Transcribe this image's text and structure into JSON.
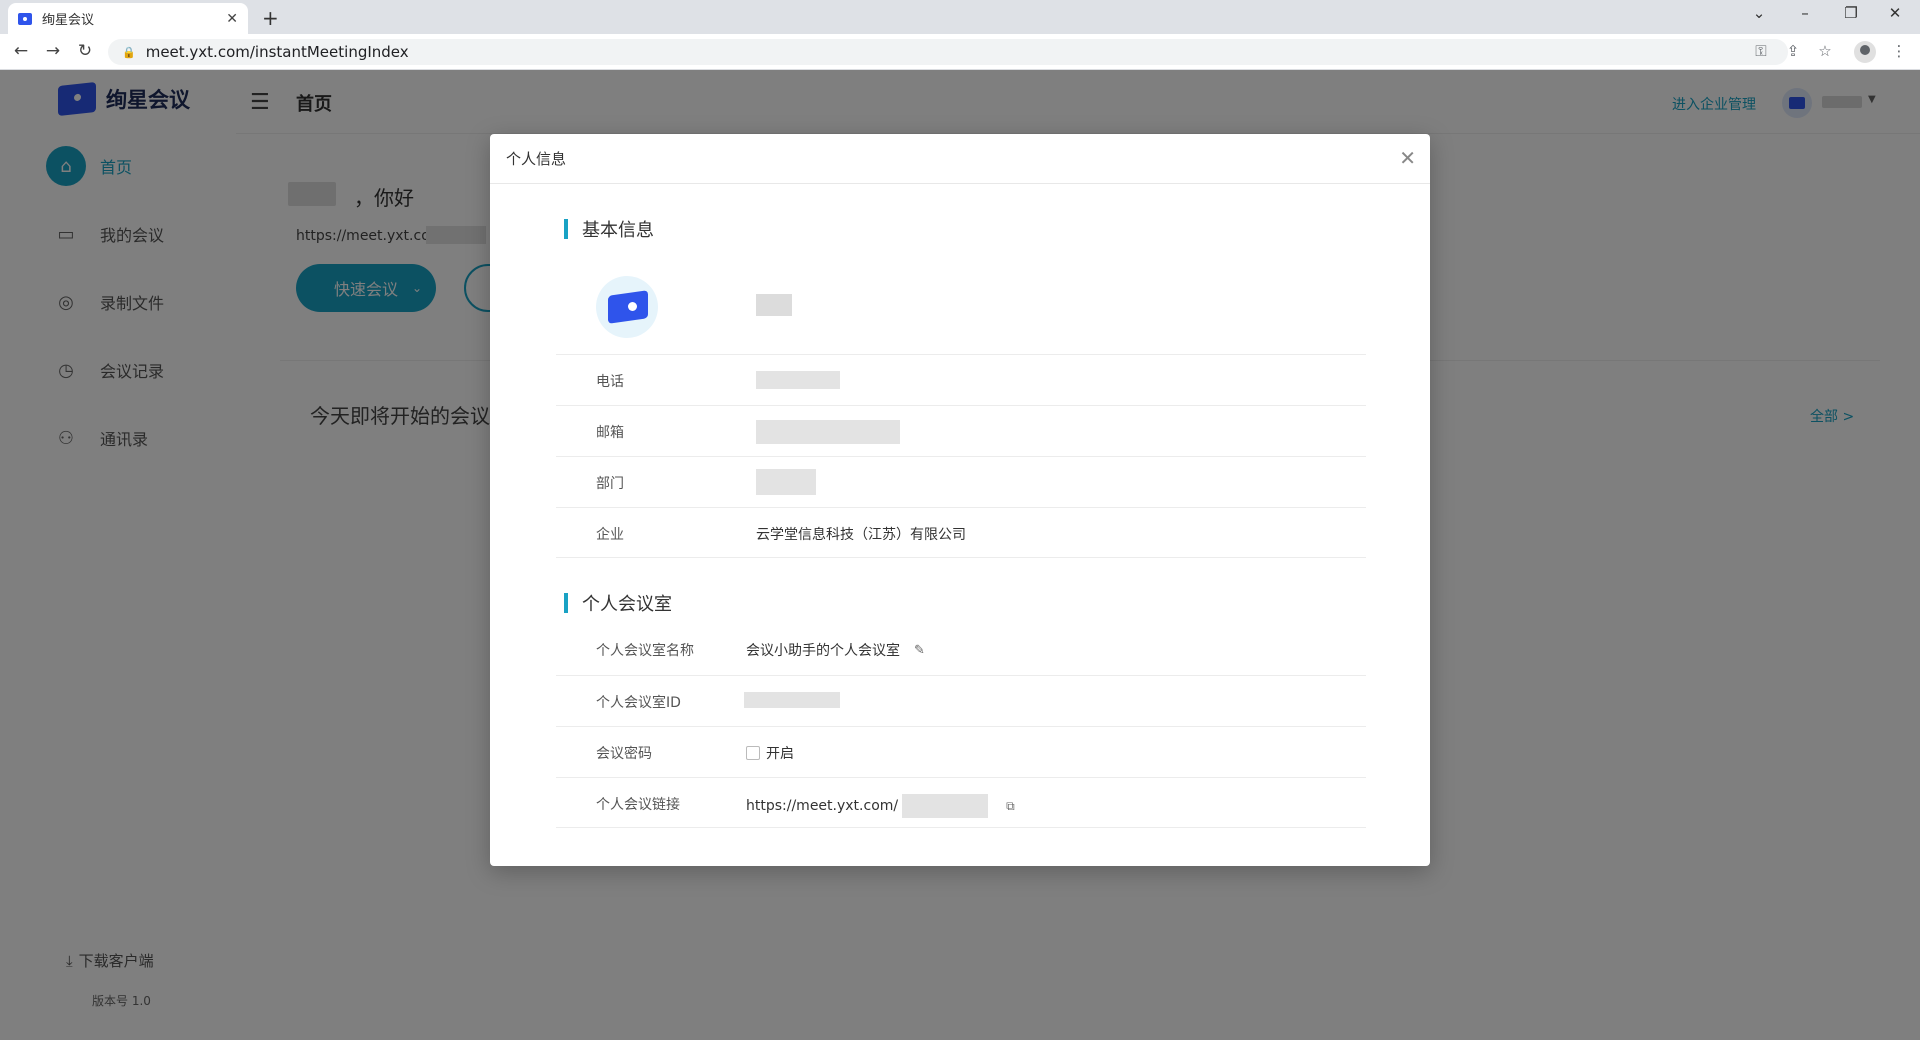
{
  "browser": {
    "tab_title": "绚星会议",
    "url": "meet.yxt.com/instantMeetingIndex"
  },
  "sidebar": {
    "brand": "绚星会议",
    "items": [
      {
        "label": "首页",
        "icon": "home-icon"
      },
      {
        "label": "我的会议",
        "icon": "calendar-icon"
      },
      {
        "label": "录制文件",
        "icon": "record-icon"
      },
      {
        "label": "会议记录",
        "icon": "clock-icon"
      },
      {
        "label": "通讯录",
        "icon": "contacts-icon"
      }
    ],
    "download_label": "下载客户端",
    "version": "版本号 1.0"
  },
  "header": {
    "title": "首页",
    "enterprise_link": "进入企业管理"
  },
  "main": {
    "greeting": "，你好",
    "link_prefix": "https://meet.yxt.com/",
    "quick_meeting": "快速会议",
    "upcoming_title": "今天即将开始的会议",
    "all_link": "全部 >"
  },
  "modal": {
    "title": "个人信息",
    "basic_section": "基本信息",
    "rows": {
      "phone_label": "电话",
      "email_label": "邮箱",
      "dept_label": "部门",
      "company_label": "企业",
      "company_value": "云学堂信息科技（江苏）有限公司"
    },
    "room_section": "个人会议室",
    "room": {
      "name_label": "个人会议室名称",
      "name_value": "会议小助手的个人会议室",
      "id_label": "个人会议室ID",
      "password_label": "会议密码",
      "password_option": "开启",
      "link_label": "个人会议链接",
      "link_value": "https://meet.yxt.com/"
    }
  },
  "colors": {
    "accent": "#19a2c4",
    "brand": "#2f54eb"
  }
}
